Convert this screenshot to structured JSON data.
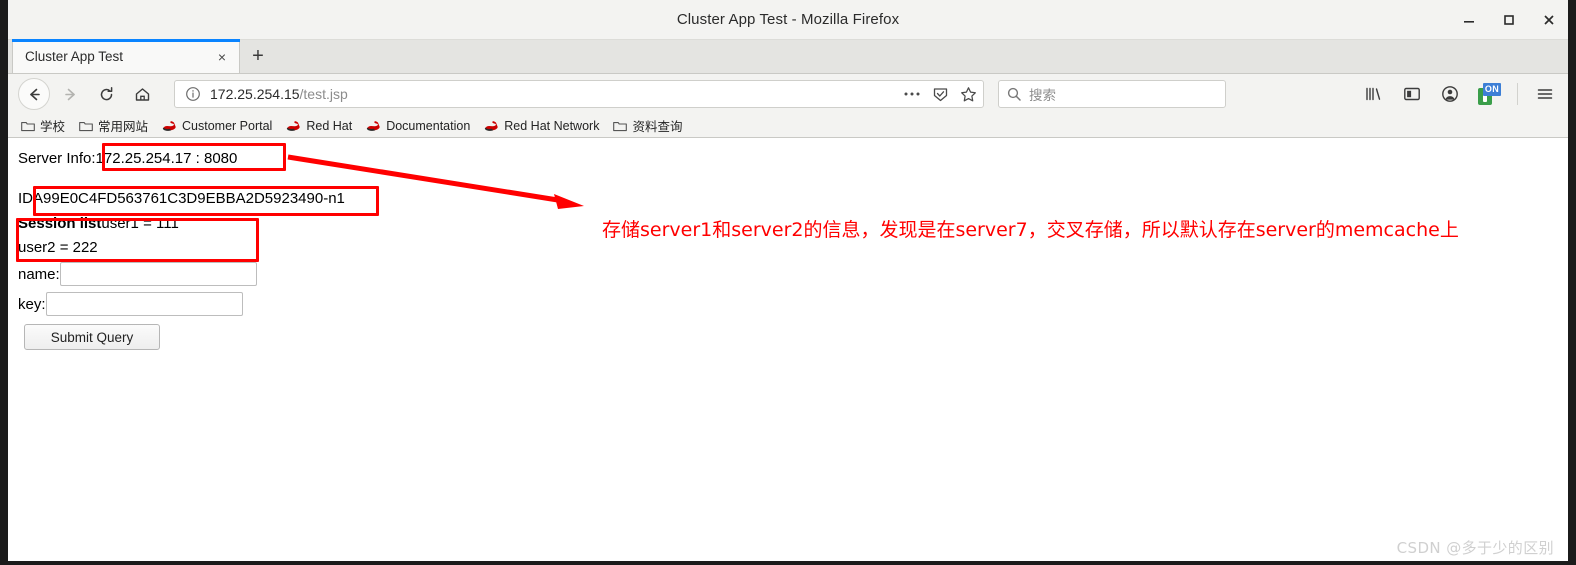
{
  "window": {
    "title": "Cluster App Test - Mozilla Firefox",
    "minimize_label": "Minimize",
    "maximize_label": "Maximize",
    "close_label": "Close"
  },
  "tabs": {
    "items": [
      {
        "label": "Cluster App Test",
        "close_label": "×"
      }
    ],
    "new_tab_label": "+"
  },
  "toolbar": {
    "back_label": "Back",
    "forward_label": "Forward",
    "reload_label": "Reload",
    "home_label": "Home",
    "url_host": "172.25.254.15",
    "url_path": "/test.jsp",
    "page_actions_label": "•••",
    "reader_label": "Reader View",
    "bookmark_label": "Bookmark this page",
    "library_label": "Library",
    "sidebar_label": "Sidebars",
    "account_label": "Account",
    "extension_label": "Extension",
    "extension_badge": "ON",
    "menu_label": "Open menu"
  },
  "search": {
    "placeholder": "搜索"
  },
  "bookmarks": [
    {
      "label": "学校",
      "icon": "folder-icon"
    },
    {
      "label": "常用网站",
      "icon": "folder-icon"
    },
    {
      "label": "Customer Portal",
      "icon": "redhat-icon"
    },
    {
      "label": "Red Hat",
      "icon": "redhat-icon"
    },
    {
      "label": "Documentation",
      "icon": "redhat-icon"
    },
    {
      "label": "Red Hat Network",
      "icon": "redhat-icon"
    },
    {
      "label": "资料查询",
      "icon": "folder-icon"
    }
  ],
  "page": {
    "server_info_label": "Server Info:",
    "server_info_value": "172.25.254.17 : 8080",
    "id_label": "ID",
    "id_value": "A99E0C4FD563761C3D9EBBA2D5923490-n1",
    "session_list_label": "Session list",
    "session_entries": [
      "user1 = 111",
      "user2 = 222"
    ],
    "name_label": "name:",
    "name_value": "",
    "key_label": "key:",
    "key_value": "",
    "submit_label": "Submit Query"
  },
  "annotation": {
    "text": "存储server1和server2的信息，发现是在server7，交叉存储，所以默认存在server的memcache上",
    "color": "#ff0000"
  },
  "watermark": {
    "text": "CSDN @多于少的区别"
  },
  "colors": {
    "accent_tab": "#0a84ff",
    "annotation_red": "#ff0000",
    "extension_green": "#3a9e4a",
    "extension_badge_blue": "#3d7fd6"
  }
}
